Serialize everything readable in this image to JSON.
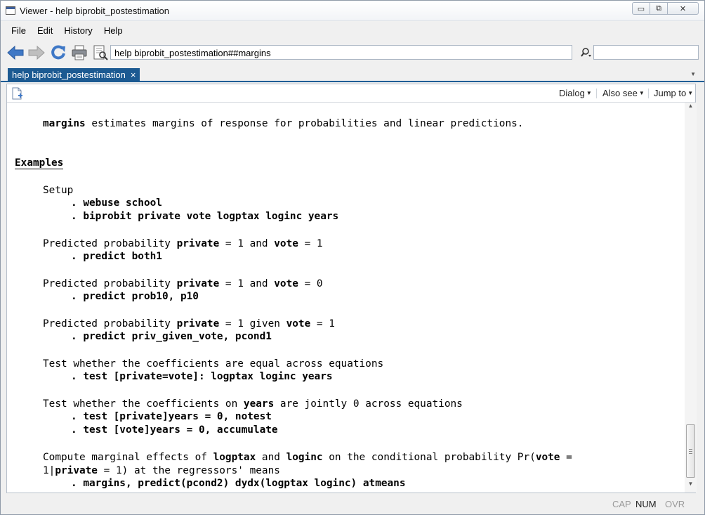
{
  "window": {
    "title": "Viewer - help biprobit_postestimation",
    "min_glyph": "▭",
    "max_glyph": "⧉",
    "close_glyph": "✕"
  },
  "menu": [
    "File",
    "Edit",
    "History",
    "Help"
  ],
  "toolbar": {
    "icons": [
      "back-icon",
      "forward-icon",
      "refresh-icon",
      "print-icon",
      "find-icon"
    ],
    "address_value": "help biprobit_postestimation##margins",
    "search_value": ""
  },
  "tabs": [
    {
      "label": "help biprobit_postestimation",
      "close": "×"
    }
  ],
  "viewer_toolbar": {
    "dialog": "Dialog",
    "also_see": "Also see",
    "jump_to": "Jump to"
  },
  "content": {
    "intro_cmd": "margins",
    "intro_rest": " estimates margins of response for probabilities and linear predictions.",
    "heading": "Examples",
    "setup_label": "Setup",
    "setup_cmd1": ". webuse school",
    "setup_cmd2": ". biprobit private vote logptax loginc years",
    "pp1_prefix": "Predicted probability ",
    "pp1_var1": "private",
    "pp1_mid": " = 1 and ",
    "pp1_var2": "vote",
    "pp1_tail": " = 1",
    "pp1_cmd": ". predict both1",
    "pp2_prefix": "Predicted probability ",
    "pp2_var1": "private",
    "pp2_mid": " = 1 and ",
    "pp2_var2": "vote",
    "pp2_tail": " = 0",
    "pp2_cmd": ". predict prob10, p10",
    "pp3_prefix": "Predicted probability ",
    "pp3_var1": "private",
    "pp3_mid": " = 1 given ",
    "pp3_var2": "vote",
    "pp3_tail": " = 1",
    "pp3_cmd": ". predict priv_given_vote, pcond1",
    "test1_label": "Test whether the coefficients are equal across equations",
    "test1_cmd": ". test [private=vote]: logptax loginc years",
    "test2_prefix": "Test whether the coefficients on ",
    "test2_var": "years",
    "test2_tail": " are jointly 0 across equations",
    "test2_cmd1": ". test [private]years = 0, notest",
    "test2_cmd2": ". test [vote]years = 0, accumulate",
    "cm_prefix": "Compute marginal effects of ",
    "cm_var1": "logptax",
    "cm_and": " and ",
    "cm_var2": "loginc",
    "cm_mid": " on the conditional probability Pr(",
    "cm_var3": "vote",
    "cm_eq": " =",
    "cm2_one": "1|",
    "cm2_var": "private",
    "cm2_tail": " = 1) at the regressors' means",
    "cm_cmd": ". margins, predict(pcond2) dydx(logptax loginc) atmeans"
  },
  "status": {
    "cap": "CAP",
    "num": "NUM",
    "ovr": "OVR"
  }
}
